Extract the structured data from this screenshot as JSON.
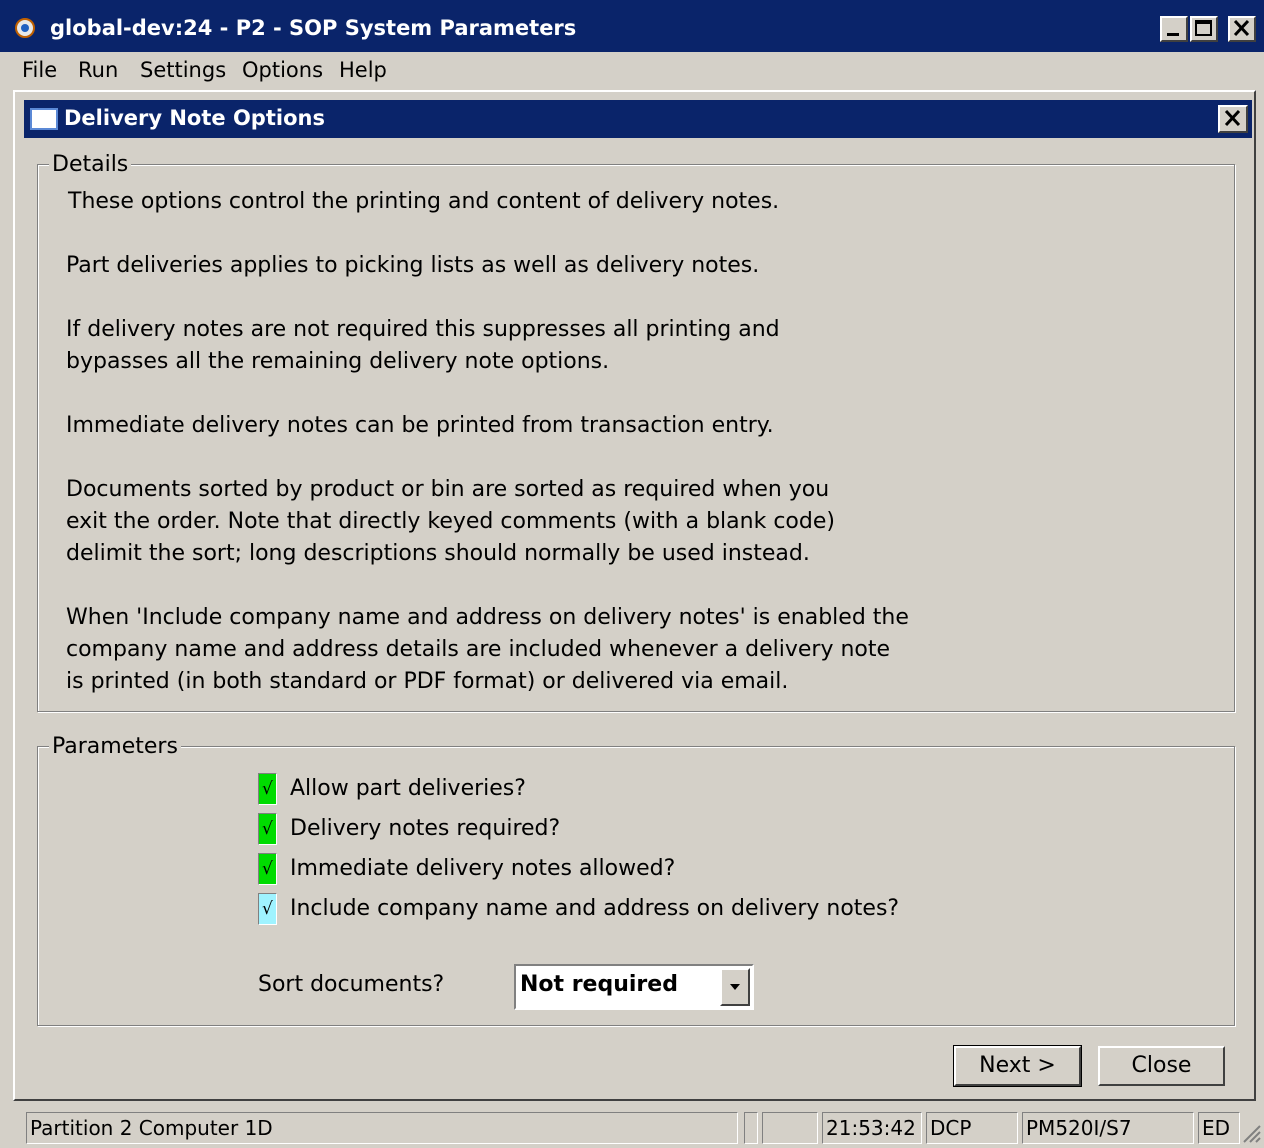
{
  "window": {
    "title": "global-dev:24 - P2 - SOP System Parameters"
  },
  "menu": [
    "File",
    "Run",
    "Settings",
    "Options",
    "Help"
  ],
  "dialog": {
    "title": "Delivery Note Options",
    "details_label": "Details",
    "details_lines": [
      "These options control the printing and content of delivery notes.",
      "Part deliveries applies to picking lists as well as delivery notes.",
      "If delivery notes are not required this suppresses all printing and",
      "bypasses all the remaining delivery note options.",
      "Immediate delivery notes can be printed from transaction entry.",
      "Documents sorted by product or bin are sorted as required when you",
      "exit the order. Note that directly keyed comments (with a blank code)",
      "delimit the sort; long descriptions should normally be used instead.",
      "When 'Include company name and address on delivery notes' is enabled the",
      "company name and address details are included whenever a delivery note",
      "is printed (in both standard or PDF format) or delivered via email."
    ],
    "parameters_label": "Parameters",
    "checkboxes": [
      {
        "label": "Allow part deliveries?",
        "checked": true,
        "color": "#00dc00"
      },
      {
        "label": "Delivery notes required?",
        "checked": true,
        "color": "#00dc00"
      },
      {
        "label": "Immediate delivery notes allowed?",
        "checked": true,
        "color": "#00dc00"
      },
      {
        "label": "Include company name and address on delivery notes?",
        "checked": true,
        "color": "#9ff3ff"
      }
    ],
    "sort_label": "Sort documents?",
    "sort_value": "Not required",
    "tick": "√",
    "next_label": "Next >",
    "close_label": "Close"
  },
  "status": {
    "partition": "Partition 2 Computer 1D",
    "time": "21:53:42",
    "user": "DCP",
    "program": "PM520I/S7",
    "mode": "ED"
  }
}
